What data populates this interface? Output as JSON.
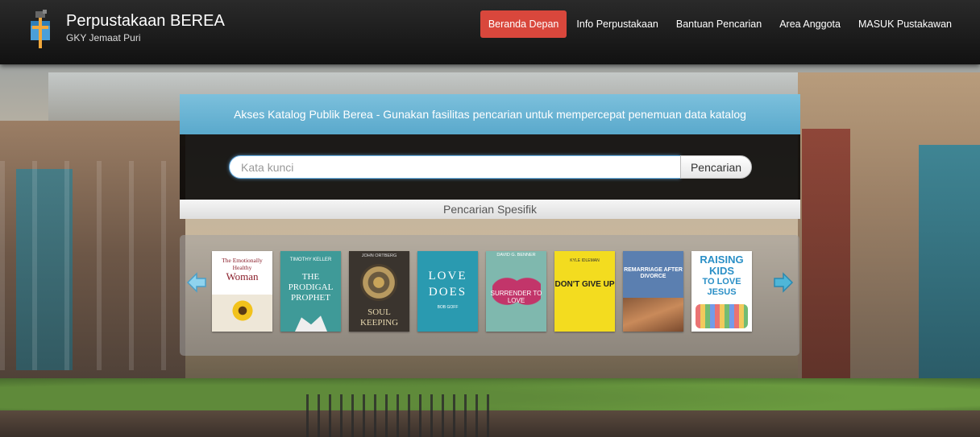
{
  "header": {
    "title": "Perpustakaan BEREA",
    "subtitle": "GKY Jemaat Puri",
    "logo_icon": "library-logo-icon"
  },
  "nav": {
    "items": [
      {
        "label": "Beranda Depan",
        "active": true
      },
      {
        "label": "Info Perpustakaan",
        "active": false
      },
      {
        "label": "Bantuan Pencarian",
        "active": false
      },
      {
        "label": "Area Anggota",
        "active": false
      },
      {
        "label": "MASUK Pustakawan",
        "active": false
      }
    ]
  },
  "search": {
    "heading": "Akses Katalog Publik Berea - Gunakan fasilitas pencarian untuk mempercepat penemuan data katalog",
    "placeholder": "Kata kunci",
    "value": "",
    "button_label": "Pencarian",
    "specific_label": "Pencarian Spesifik"
  },
  "carousel": {
    "prev_icon": "arrow-left-icon",
    "next_icon": "arrow-right-icon",
    "books": [
      {
        "author": "",
        "title_line1": "The Emotionally Healthy",
        "title_line2": "Woman"
      },
      {
        "author": "TIMOTHY KELLER",
        "title_line1": "THE PRODIGAL PROPHET",
        "title_line2": ""
      },
      {
        "author": "JOHN ORTBERG",
        "title_line1": "SOUL KEEPING",
        "title_line2": ""
      },
      {
        "author": "",
        "title_line1": "LOVE DOES",
        "title_line2": "BOB GOFF"
      },
      {
        "author": "DAVID G. BENNER",
        "title_line1": "SURRENDER TO LOVE",
        "title_line2": ""
      },
      {
        "author": "KYLE IDLEMAN",
        "title_line1": "DON'T GIVE UP",
        "title_line2": ""
      },
      {
        "author": "",
        "title_line1": "REMARRIAGE AFTER DIVORCE",
        "title_line2": ""
      },
      {
        "author": "",
        "title_line1": "RAISING KIDS",
        "title_line2": "TO LOVE JESUS"
      }
    ]
  },
  "colors": {
    "active_nav": "#d9473c",
    "panel_header": "#5aa9cc",
    "navbar": "#111111"
  }
}
